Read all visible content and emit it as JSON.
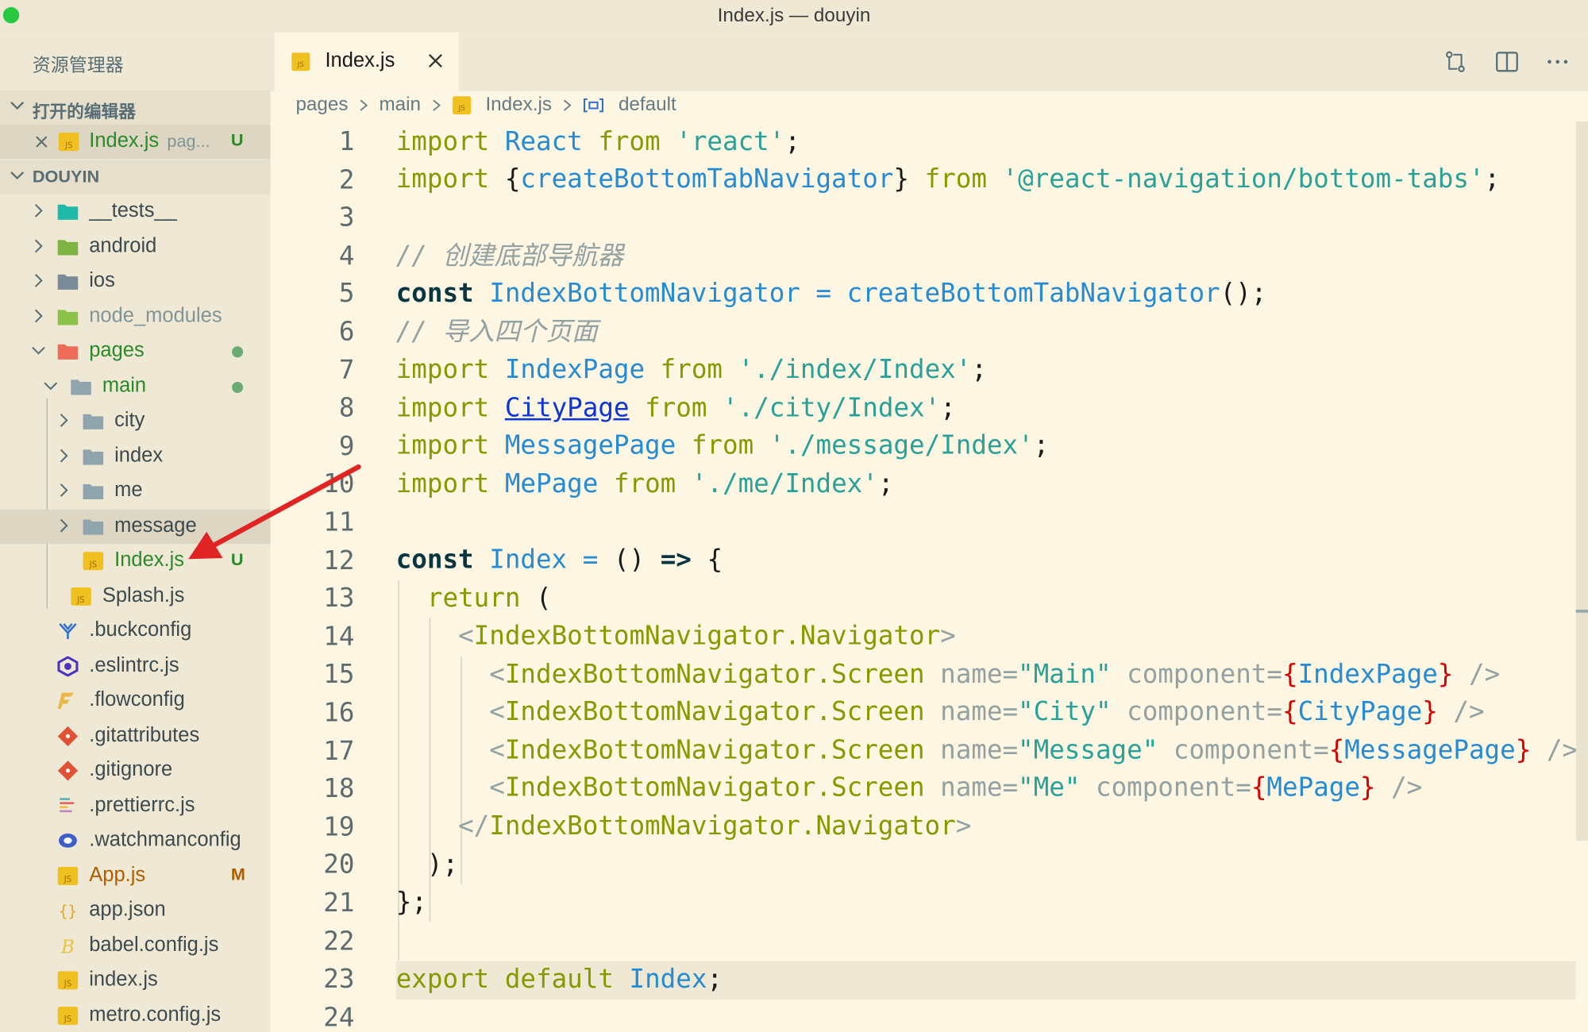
{
  "window": {
    "title": "Index.js — douyin"
  },
  "sidebar": {
    "title": "资源管理器",
    "open_editors": {
      "label": "打开的编辑器",
      "file": "Index.js",
      "desc": "pag...",
      "badge": "U"
    },
    "project": {
      "label": "DOUYIN",
      "items": [
        {
          "name": "__tests__"
        },
        {
          "name": "android"
        },
        {
          "name": "ios"
        },
        {
          "name": "node_modules"
        },
        {
          "name": "pages"
        },
        {
          "name": "main"
        },
        {
          "name": "city"
        },
        {
          "name": "index"
        },
        {
          "name": "me"
        },
        {
          "name": "message"
        },
        {
          "name": "Index.js",
          "badge": "U"
        },
        {
          "name": "Splash.js"
        },
        {
          "name": ".buckconfig"
        },
        {
          "name": ".eslintrc.js"
        },
        {
          "name": ".flowconfig"
        },
        {
          "name": ".gitattributes"
        },
        {
          "name": ".gitignore"
        },
        {
          "name": ".prettierrc.js"
        },
        {
          "name": ".watchmanconfig"
        },
        {
          "name": "App.js",
          "badge": "M"
        },
        {
          "name": "app.json"
        },
        {
          "name": "babel.config.js"
        },
        {
          "name": "index.js"
        },
        {
          "name": "metro.config.js"
        }
      ]
    }
  },
  "tab": {
    "name": "Index.js"
  },
  "breadcrumb": {
    "p1": "pages",
    "p2": "main",
    "p3": "Index.js",
    "p4": "default"
  },
  "code": {
    "line_numbers": [
      "1",
      "2",
      "3",
      "4",
      "5",
      "6",
      "7",
      "8",
      "9",
      "10",
      "11",
      "12",
      "13",
      "14",
      "15",
      "16",
      "17",
      "18",
      "19",
      "20",
      "21",
      "22",
      "23",
      "24"
    ],
    "l1": {
      "a": "import",
      "b": "React",
      "c": "from",
      "d": "'react'",
      "e": ";"
    },
    "l2": {
      "a": "import",
      "b": "{",
      "c": "createBottomTabNavigator",
      "d": "}",
      "e": "from",
      "f": "'@react-navigation/bottom-tabs'",
      "g": ";"
    },
    "l4": {
      "a": "// 创建底部导航器"
    },
    "l5": {
      "a": "const",
      "b": "IndexBottomNavigator",
      "c": "=",
      "d": "createBottomTabNavigator",
      "e": "();"
    },
    "l6": {
      "a": "// 导入四个页面"
    },
    "l7": {
      "a": "import",
      "b": "IndexPage",
      "c": "from",
      "d": "'./index/Index'",
      "e": ";"
    },
    "l8": {
      "a": "import",
      "b": "CityPage",
      "c": "from",
      "d": "'./city/Index'",
      "e": ";"
    },
    "l9": {
      "a": "import",
      "b": "MessagePage",
      "c": "from",
      "d": "'./message/Index'",
      "e": ";"
    },
    "l10": {
      "a": "import",
      "b": "MePage",
      "c": "from",
      "d": "'./me/Index'",
      "e": ";"
    },
    "l12": {
      "a": "const",
      "b": "Index",
      "c": "=",
      "d": "()",
      "e": "=>",
      "f": "{"
    },
    "l13": {
      "a": "return",
      "b": "("
    },
    "l14": {
      "a": "<",
      "b": "IndexBottomNavigator.Navigator",
      "c": ">"
    },
    "l15": {
      "a": "<",
      "b": "IndexBottomNavigator.Screen",
      "c": "name=",
      "d": "\"Main\"",
      "e": "component=",
      "f": "{",
      "g": "IndexPage",
      "h": "}",
      "i": "/>"
    },
    "l16": {
      "a": "<",
      "b": "IndexBottomNavigator.Screen",
      "c": "name=",
      "d": "\"City\"",
      "e": "component=",
      "f": "{",
      "g": "CityPage",
      "h": "}",
      "i": "/>"
    },
    "l17": {
      "a": "<",
      "b": "IndexBottomNavigator.Screen",
      "c": "name=",
      "d": "\"Message\"",
      "e": "component=",
      "f": "{",
      "g": "MessagePage",
      "h": "}",
      "i": "/>"
    },
    "l18": {
      "a": "<",
      "b": "IndexBottomNavigator.Screen",
      "c": "name=",
      "d": "\"Me\"",
      "e": "component=",
      "f": "{",
      "g": "MePage",
      "h": "}",
      "i": "/>"
    },
    "l19": {
      "a": "</",
      "b": "IndexBottomNavigator.Navigator",
      "c": ">"
    },
    "l20": {
      "a": ");"
    },
    "l21": {
      "a": "};"
    },
    "l23": {
      "a": "export",
      "b": "default",
      "c": "Index",
      "d": ";"
    }
  },
  "colors": {
    "keyword": "#859900",
    "identifier": "#268bd2",
    "string": "#2aa198",
    "comment": "#93a1a1",
    "brace": "#d30102",
    "editor_bg": "#fdf6e3",
    "sidebar_bg": "#eee8d5",
    "untracked": "#2a8a2a",
    "modified": "#b05d00"
  }
}
